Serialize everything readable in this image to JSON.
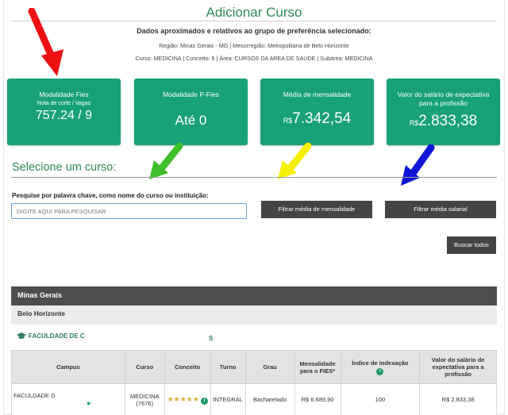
{
  "header": {
    "title": "Adicionar Curso",
    "subtitle": "Dados aproximados e relativos ao grupo de preferência selecionado:",
    "region_line": "Região: Minas Gerais - MG | Mesorregião: Metropolitana de Belo Horizonte",
    "course_line": "Curso: MEDICINA | Conceito: 5 | Área: CURSOS DA AREA DE SAUDE | Subárea: MEDICINA"
  },
  "cards": {
    "fies": {
      "label": "Modalidade Fies",
      "sublabel": "Nota de corte / Vagas",
      "value": "757.24 / 9"
    },
    "pfies": {
      "label": "Modalidade P-Fies",
      "value": "Até 0"
    },
    "mensalidade": {
      "label": "Média de mensalidade",
      "currency": "R$",
      "value": "7.342,54"
    },
    "salario": {
      "label": "Valor do salário de expectativa para a profissão",
      "currency": "R$",
      "value": "2.833,38"
    }
  },
  "arrows": {
    "red": "#ee1111",
    "green": "#3fbf2a",
    "yellow": "#f5f000",
    "blue": "#1016d8"
  },
  "search": {
    "section_title": "Selecione um curso:",
    "label": "Pesquise por palavra chave, como nome do curso ou instituição:",
    "placeholder": "DIGITE AQUI PARA PESQUISAR",
    "filter_mensalidade": "Filtrar média de mensalidade",
    "filter_salarial": "Filtrar média salarial",
    "search_all": "Buscar todos"
  },
  "results": {
    "state": "Minas Gerais",
    "city": "Belo Horizonte",
    "institution": "FACULDADE DE C",
    "institution_tail": "S",
    "columns": [
      "Campus",
      "Curso",
      "Conceito",
      "Turno",
      "Grau",
      "Mensalidade para o FIES*",
      "Índice de indexação",
      "Valor do salário de expectativa para a profissão"
    ],
    "rows": [
      {
        "campus": "FACULDADE D",
        "curso": "MEDICINA (7676)",
        "stars": "★★★★★",
        "turno": "INTEGRAL",
        "grau": "Bacharelado",
        "mensalidade": "R$ 6.689,90",
        "indice": "100",
        "salario": "R$ 2.833,38"
      }
    ]
  },
  "colors": {
    "brand": "#18a179",
    "title_green": "#2e8b57",
    "dark_button": "#444444"
  }
}
